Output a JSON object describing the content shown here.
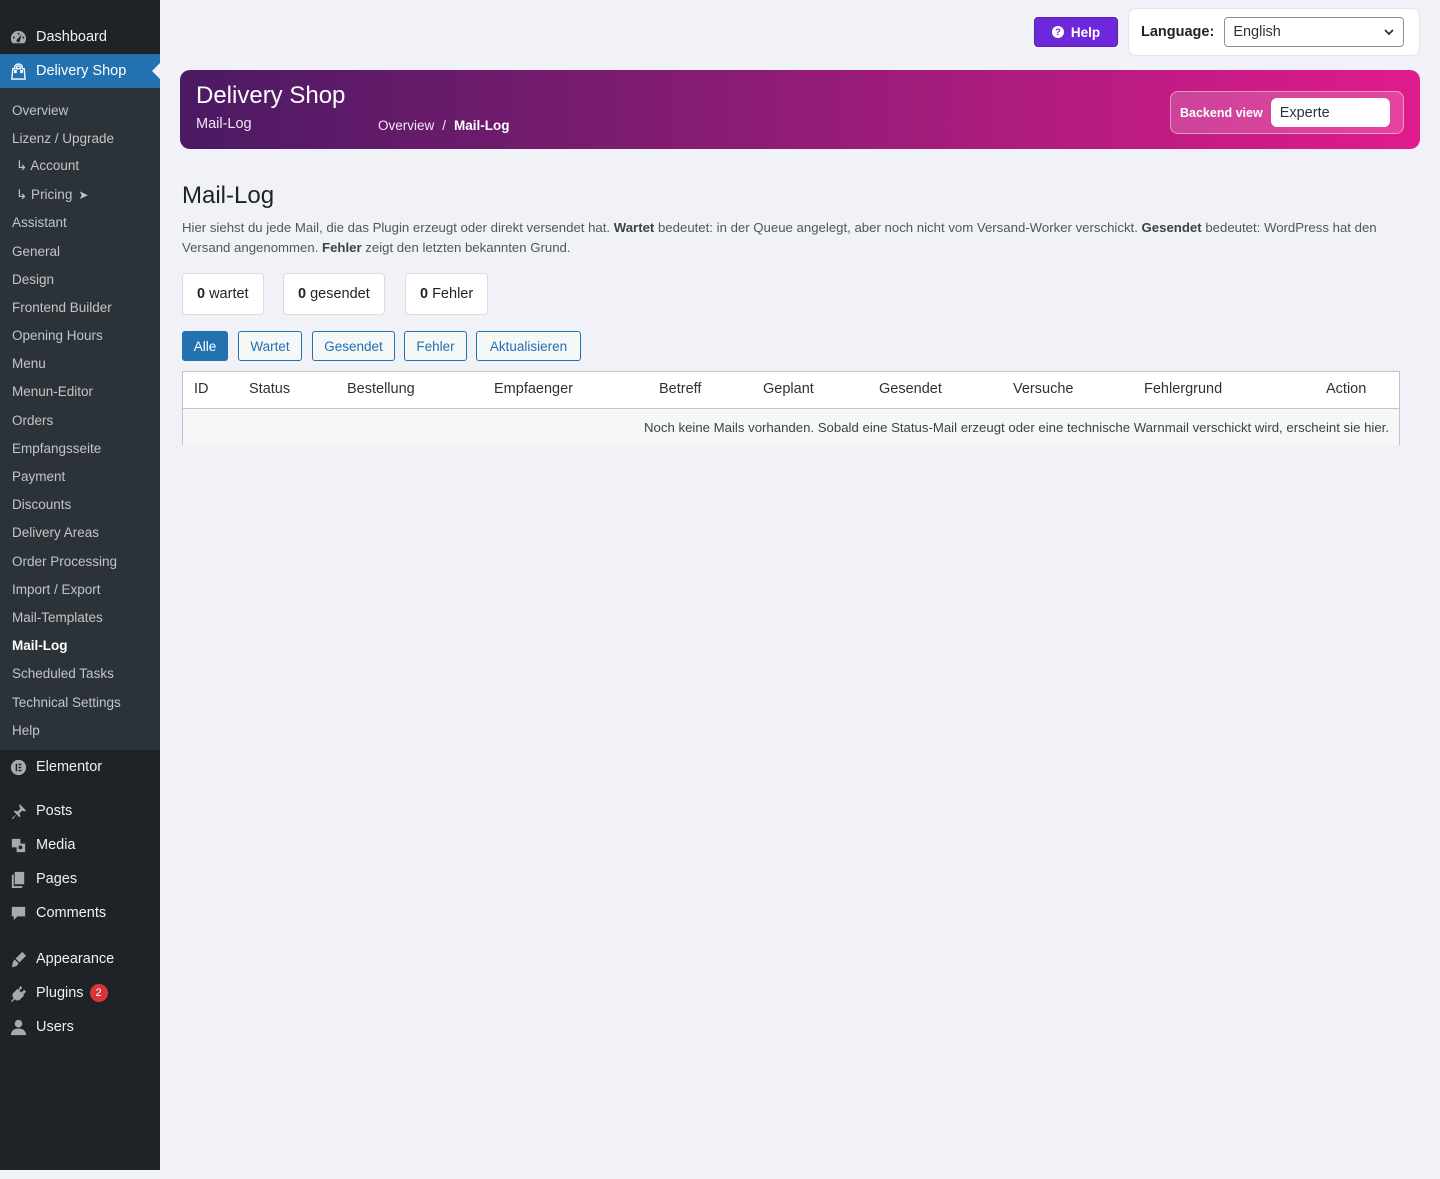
{
  "sidebar": {
    "top": [
      {
        "label": "Dashboard",
        "icon": "dashboard-icon"
      },
      {
        "label": "Delivery Shop",
        "icon": "shop-bag-icon"
      }
    ],
    "submenu": [
      {
        "label": "Overview"
      },
      {
        "label": "Lizenz / Upgrade"
      },
      {
        "label": "↳ Account"
      },
      {
        "label": "↳ Pricing",
        "suffix": "➤"
      },
      {
        "label": "Assistant"
      },
      {
        "label": "General"
      },
      {
        "label": "Design"
      },
      {
        "label": "Frontend Builder"
      },
      {
        "label": "Opening Hours"
      },
      {
        "label": "Menu"
      },
      {
        "label": "Menun-Editor"
      },
      {
        "label": "Orders"
      },
      {
        "label": "Empfangsseite"
      },
      {
        "label": "Payment"
      },
      {
        "label": "Discounts"
      },
      {
        "label": "Delivery Areas"
      },
      {
        "label": "Order Processing"
      },
      {
        "label": "Import / Export"
      },
      {
        "label": "Mail-Templates"
      },
      {
        "label": "Mail-Log"
      },
      {
        "label": "Scheduled Tasks"
      },
      {
        "label": "Technical Settings"
      },
      {
        "label": "Help"
      }
    ],
    "bottom": [
      {
        "label": "Elementor",
        "icon": "elementor-icon"
      },
      {
        "label": "Posts",
        "icon": "pin-icon"
      },
      {
        "label": "Media",
        "icon": "media-icon"
      },
      {
        "label": "Pages",
        "icon": "pages-icon"
      },
      {
        "label": "Comments",
        "icon": "comment-icon"
      },
      {
        "label": "Appearance",
        "icon": "brush-icon"
      },
      {
        "label": "Plugins",
        "icon": "plugin-icon",
        "badge": "2"
      },
      {
        "label": "Users",
        "icon": "user-icon"
      }
    ]
  },
  "topbar": {
    "help_label": "Help",
    "language_label": "Language:",
    "language_value": "English"
  },
  "banner": {
    "title": "Delivery Shop",
    "subtitle": "Mail-Log",
    "breadcrumb": [
      "Overview",
      "/",
      "Mail-Log"
    ],
    "backend_view_label": "Backend view",
    "backend_view_value": "Experte"
  },
  "main": {
    "title": "Mail-Log",
    "desc_1": "Hier siehst du jede Mail, die das Plugin erzeugt oder direkt versendet hat. ",
    "desc_b1": "Wartet",
    "desc_2": " bedeutet: in der Queue angelegt, aber noch nicht vom Versand-Worker verschickt. ",
    "desc_b2": "Gesendet",
    "desc_3": " bedeutet: WordPress hat den Versand angenommen. ",
    "desc_b3": "Fehler",
    "desc_4": " zeigt den letzten bekannten Grund.",
    "stats": [
      {
        "count": "0",
        "label": "wartet"
      },
      {
        "count": "0",
        "label": "gesendet"
      },
      {
        "count": "0",
        "label": "Fehler"
      }
    ],
    "filters": [
      "Alle",
      "Wartet",
      "Gesendet",
      "Fehler",
      "Aktualisieren"
    ],
    "table": {
      "columns": [
        "ID",
        "Status",
        "Bestellung",
        "Empfaenger",
        "Betreff",
        "Geplant",
        "Gesendet",
        "Versuche",
        "Fehlergrund",
        "Action"
      ],
      "empty": "Noch keine Mails vorhanden. Sobald eine Status-Mail erzeugt oder eine technische Warnmail verschickt wird, erscheint sie hier."
    }
  },
  "colors": {
    "accent": "#2271b1",
    "sidebar_bg": "#1d2327",
    "help": "#6d28d9",
    "badge": "#d63638"
  }
}
